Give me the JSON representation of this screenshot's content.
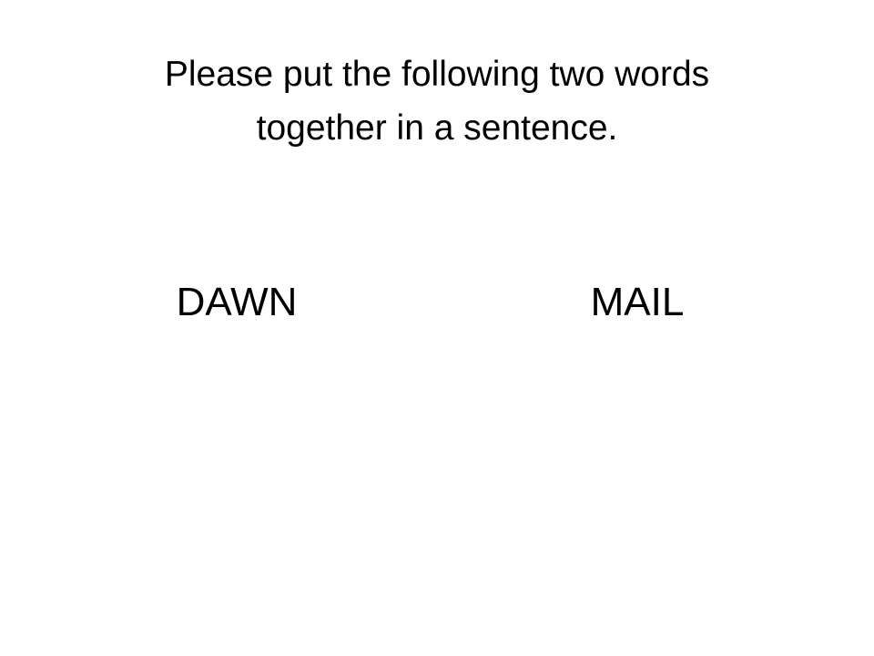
{
  "slide": {
    "title_line_1": "Please put the following two words",
    "title_line_2": "together in a sentence.",
    "words": [
      "DAWN",
      "MAIL"
    ]
  }
}
